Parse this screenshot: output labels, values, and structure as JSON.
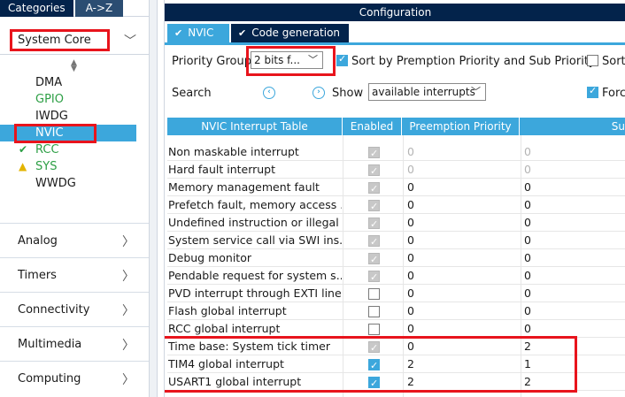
{
  "sidebar": {
    "tabs": [
      "Categories",
      "A->Z"
    ],
    "active_category": "System Core",
    "peripherals": [
      {
        "name": "DMA",
        "status": "",
        "color": "normal"
      },
      {
        "name": "GPIO",
        "status": "",
        "color": "green"
      },
      {
        "name": "IWDG",
        "status": "",
        "color": "normal"
      },
      {
        "name": "NVIC",
        "status": "",
        "color": "selected"
      },
      {
        "name": "RCC",
        "status": "check-icon",
        "color": "green"
      },
      {
        "name": "SYS",
        "status": "warning-icon",
        "color": "green"
      },
      {
        "name": "WWDG",
        "status": "",
        "color": "normal"
      }
    ],
    "categories": [
      "Analog",
      "Timers",
      "Connectivity",
      "Multimedia",
      "Computing"
    ]
  },
  "config": {
    "title": "Configuration",
    "tabs": [
      {
        "label": "NVIC",
        "icon": "check-circle-icon"
      },
      {
        "label": "Code generation",
        "icon": "check-circle-icon"
      }
    ],
    "priority_group_label": "Priority Group",
    "priority_group_value": "2 bits f...",
    "sort_label": "Sort by Premption Priority and Sub Priority",
    "sort_checked": true,
    "sort2_label": "Sort",
    "search_label": "Search",
    "show_label": "Show",
    "show_value": "available interrupts",
    "force_label": "Forc",
    "columns": [
      "NVIC Interrupt Table",
      "Enabled",
      "Preemption Priority",
      "Su"
    ],
    "rows": [
      {
        "name": "Non maskable interrupt",
        "enabled": "locked",
        "preempt": "0",
        "sub": "0",
        "dim": true
      },
      {
        "name": "Hard fault interrupt",
        "enabled": "locked",
        "preempt": "0",
        "sub": "0",
        "dim": true
      },
      {
        "name": "Memory management fault",
        "enabled": "locked",
        "preempt": "0",
        "sub": "0",
        "dim": false
      },
      {
        "name": "Prefetch fault, memory access ...",
        "enabled": "locked",
        "preempt": "0",
        "sub": "0",
        "dim": false
      },
      {
        "name": "Undefined instruction or illegal ...",
        "enabled": "locked",
        "preempt": "0",
        "sub": "0",
        "dim": false
      },
      {
        "name": "System service call via SWI ins...",
        "enabled": "locked",
        "preempt": "0",
        "sub": "0",
        "dim": false
      },
      {
        "name": "Debug monitor",
        "enabled": "locked",
        "preempt": "0",
        "sub": "0",
        "dim": false
      },
      {
        "name": "Pendable request for system s...",
        "enabled": "locked",
        "preempt": "0",
        "sub": "0",
        "dim": false
      },
      {
        "name": "PVD interrupt through EXTI line ...",
        "enabled": "off",
        "preempt": "0",
        "sub": "0",
        "dim": false
      },
      {
        "name": "Flash global interrupt",
        "enabled": "off",
        "preempt": "0",
        "sub": "0",
        "dim": false
      },
      {
        "name": "RCC global interrupt",
        "enabled": "off",
        "preempt": "0",
        "sub": "0",
        "dim": false
      },
      {
        "name": "Time base: System tick timer",
        "enabled": "locked",
        "preempt": "0",
        "sub": "2",
        "dim": false
      },
      {
        "name": "TIM4 global interrupt",
        "enabled": "on",
        "preempt": "2",
        "sub": "1",
        "dim": false
      },
      {
        "name": "USART1 global interrupt",
        "enabled": "on",
        "preempt": "2",
        "sub": "2",
        "dim": false
      }
    ]
  },
  "colors": {
    "accent": "#3ca7dc",
    "dark": "#03234b",
    "highlight": "#e8141c",
    "ok": "#2d9f45",
    "warn": "#e3b400"
  }
}
